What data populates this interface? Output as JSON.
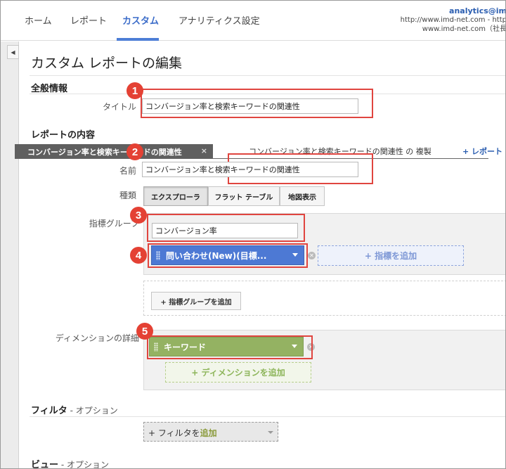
{
  "nav": {
    "tabs": [
      "ホーム",
      "レポート",
      "カスタム",
      "アナリティクス設定"
    ],
    "active_tab": "カスタム"
  },
  "account": {
    "email": "analytics@im",
    "line1": "http://www.imd-net.com - http",
    "line2": "www.imd-net.com（社長"
  },
  "page": {
    "title": "カスタム レポートの編集"
  },
  "general": {
    "heading": "全般情報",
    "title_label": "タイトル",
    "title_value": "コンバージョン率と検索キーワードの関連性"
  },
  "content": {
    "heading": "レポートの内容",
    "tabs": [
      "コンバージョン率と検索キーワードの関連性",
      "コンバージョン率と検索キーワードの関連性 の 複製"
    ],
    "close_glyph": "×",
    "add_tab": "+ レポート タ",
    "name_label": "名前",
    "name_value": "コンバージョン率と検索キーワードの関連性",
    "type_label": "種類",
    "types": [
      "エクスプローラ",
      "フラット テーブル",
      "地図表示"
    ],
    "active_type": "エクスプローラ",
    "metric_group_label": "指標グループ",
    "metric_group_name": "コンバージョン率",
    "metric": "問い合わせ(New)(目標...",
    "add_metric": "+ 指標を追加",
    "add_metric_group": "+ 指標グループを追加",
    "dimension_label": "ディメンションの詳細",
    "dimension": "キーワード",
    "add_dimension": "+ ディメンションを追加"
  },
  "filter": {
    "heading": "フィルタ",
    "optional": " - オプション",
    "add_prefix": "+ フィルタを",
    "add_suffix": "追加"
  },
  "view": {
    "heading": "ビュー",
    "optional": " - オプション"
  },
  "callouts": [
    "1",
    "2",
    "3",
    "4",
    "5"
  ],
  "colors": {
    "accent": "#3b6cc9",
    "callout": "#e44134",
    "metric_pill": "#4d79d4",
    "dimension_pill": "#94b262"
  }
}
